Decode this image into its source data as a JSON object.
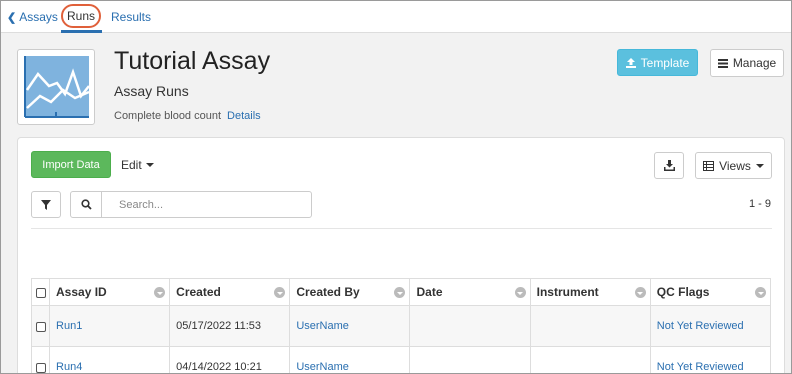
{
  "nav": {
    "back_label": "Assays",
    "tabs": [
      {
        "label": "Runs"
      },
      {
        "label": "Results"
      }
    ]
  },
  "header": {
    "title": "Tutorial Assay",
    "subtitle": "Assay Runs",
    "description": "Complete blood count",
    "details_link": "Details",
    "template_button": "Template",
    "manage_button": "Manage"
  },
  "toolbar": {
    "import_button": "Import Data",
    "edit_menu": "Edit",
    "views_button": "Views",
    "search_placeholder": "Search...",
    "pagination": "1 - 9"
  },
  "table": {
    "columns": [
      "Assay ID",
      "Created",
      "Created By",
      "Date",
      "Instrument",
      "QC Flags"
    ],
    "rows": [
      {
        "assay_id": "Run1",
        "created": "05/17/2022 11:53",
        "created_by": "UserName",
        "date": "",
        "instrument": "",
        "qc_flags": "Not Yet Reviewed"
      },
      {
        "assay_id": "Run4",
        "created": "04/14/2022 10:21",
        "created_by": "UserName",
        "date": "",
        "instrument": "",
        "qc_flags": "Not Yet Reviewed"
      }
    ]
  },
  "colors": {
    "link": "#2a6fb0",
    "template_button": "#5bc0de",
    "import_button": "#5cb85c",
    "runs_highlight": "#e0603a",
    "icon_fill": "#7fb3de"
  },
  "icons": {
    "back": "chevron-left-icon",
    "template": "upload-icon",
    "manage": "hamburger-icon",
    "download": "download-icon",
    "views": "table-grid-icon",
    "filter": "funnel-icon",
    "search": "search-icon"
  }
}
